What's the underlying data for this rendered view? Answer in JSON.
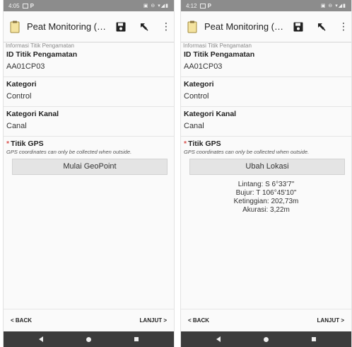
{
  "left": {
    "status_time": "4:05",
    "toolbar_title": "Peat Monitoring (…",
    "section": "Informasi Titik Pengamatan",
    "fields": [
      {
        "label": "ID Titik Pengamatan",
        "value": "AA01CP03"
      },
      {
        "label": "Kategori",
        "value": "Control"
      },
      {
        "label": "Kategori Kanal",
        "value": "Canal"
      }
    ],
    "gps_label": "Titik GPS",
    "gps_required_mark": "*",
    "gps_hint": "GPS coordinates can only be collected when outside.",
    "gps_button": "Mulai GeoPoint",
    "back": "< BACK",
    "next": "LANJUT >"
  },
  "right": {
    "status_time": "4:12",
    "toolbar_title": "Peat Monitoring (…",
    "section": "Informasi Titik Pengamatan",
    "fields": [
      {
        "label": "ID Titik Pengamatan",
        "value": "AA01CP03"
      },
      {
        "label": "Kategori",
        "value": "Control"
      },
      {
        "label": "Kategori Kanal",
        "value": "Canal"
      }
    ],
    "gps_label": "Titik GPS",
    "gps_required_mark": "*",
    "gps_hint": "GPS coordinates can only be collected when outside.",
    "gps_button": "Ubah Lokasi",
    "location": {
      "latitude": "Lintang: S 6°33'7\"",
      "longitude": "Bujur: T 106°45'10\"",
      "altitude": "Ketinggian: 202,73m",
      "accuracy": "Akurasi: 3,22m"
    },
    "back": "< BACK",
    "next": "LANJUT >"
  }
}
